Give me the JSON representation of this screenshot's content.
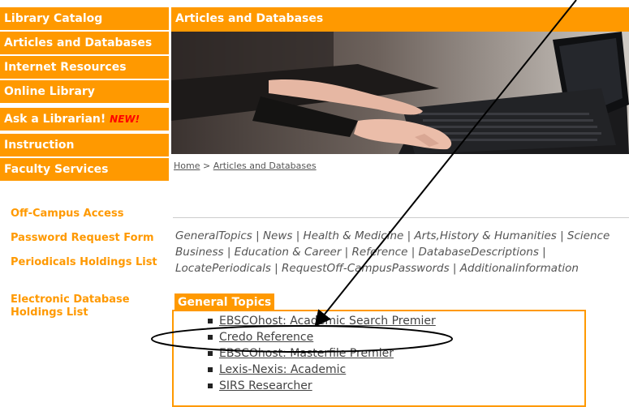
{
  "nav": {
    "items": [
      {
        "label": "Library Catalog"
      },
      {
        "label": "Articles and Databases"
      },
      {
        "label": "Internet Resources"
      },
      {
        "label": "Online Library"
      },
      {
        "label": "Ask a Librarian!",
        "badge": "NEW!"
      },
      {
        "label": "Instruction"
      },
      {
        "label": "Faculty Services"
      }
    ]
  },
  "header": {
    "title": "Articles and Databases"
  },
  "breadcrumb": {
    "home": "Home",
    "sep": " > ",
    "current": "Articles and Databases"
  },
  "side_links": [
    {
      "label": "Off-Campus Access"
    },
    {
      "label": "Password Request Form"
    },
    {
      "label": "Periodicals Holdings List"
    },
    {
      "label": "Electronic Database Holdings List"
    }
  ],
  "topics": {
    "line1": "GeneralTopics | News | Health & Medicine | Arts,History & Humanities | Science",
    "line2": "Business | Education & Career | Reference | DatabaseDescriptions |",
    "line3": "LocatePeriodicals  | RequestOff-CampusPasswords | Additionalinformation"
  },
  "general_topics": {
    "title": "General Topics",
    "items": [
      {
        "label": "EBSCOhost: Academic Search Premier"
      },
      {
        "label": "Credo Reference"
      },
      {
        "label": "EBSCOhost: Masterfile Premier"
      },
      {
        "label": "Lexis-Nexis: Academic"
      },
      {
        "label": "SIRS Researcher"
      }
    ]
  },
  "colors": {
    "accent": "#ff9900",
    "new_badge": "#ff0000",
    "text": "#555555"
  },
  "icons": {
    "bullet": "square-bullet-icon"
  }
}
